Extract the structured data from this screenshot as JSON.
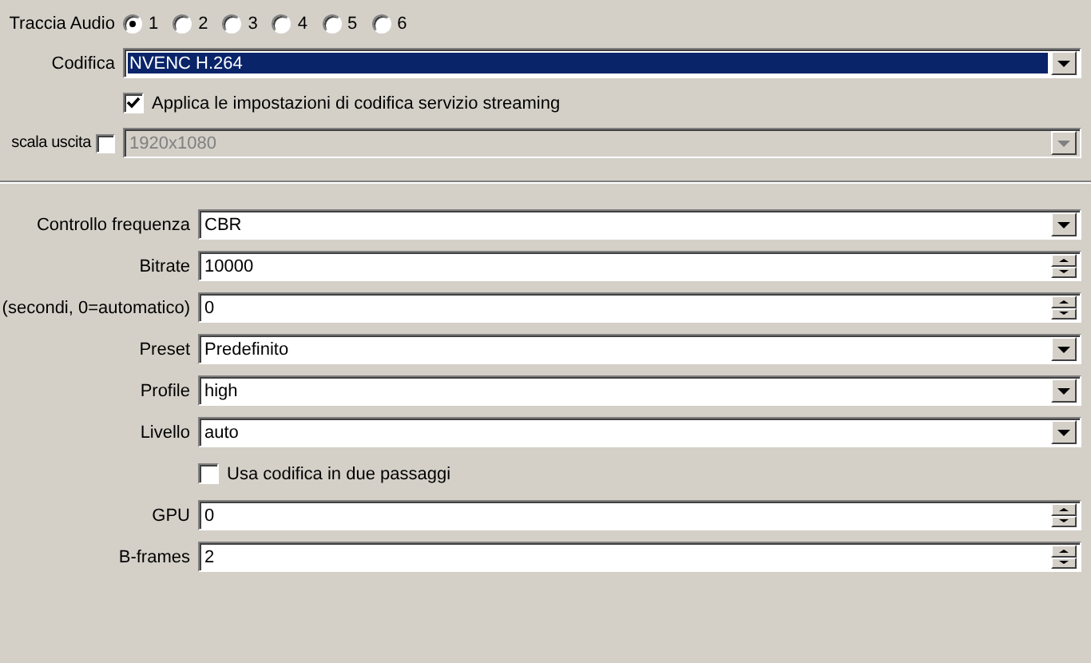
{
  "audio_track": {
    "label": "Traccia Audio",
    "options": [
      {
        "label": "1",
        "selected": true
      },
      {
        "label": "2",
        "selected": false
      },
      {
        "label": "3",
        "selected": false
      },
      {
        "label": "4",
        "selected": false
      },
      {
        "label": "5",
        "selected": false
      },
      {
        "label": "6",
        "selected": false
      }
    ]
  },
  "top_rows": [
    {
      "kind": "combo",
      "label": "Codifica",
      "value": "NVENC H.264",
      "focused": true,
      "disabled": false
    },
    {
      "kind": "check",
      "label": "Applica le impostazioni di codifica servizio streaming",
      "checked": true
    },
    {
      "kind": "rescale",
      "label": "scala uscita",
      "checked": false,
      "value": "1920x1080",
      "disabled": true
    }
  ],
  "rows": [
    {
      "kind": "combo",
      "label": "Controllo frequenza",
      "value": "CBR",
      "focused": false,
      "disabled": false
    },
    {
      "kind": "spin",
      "label": "Bitrate",
      "value": "10000"
    },
    {
      "kind": "spin",
      "label": "(secondi, 0=automatico)",
      "value": "0"
    },
    {
      "kind": "combo",
      "label": "Preset",
      "value": "Predefinito",
      "focused": false,
      "disabled": false
    },
    {
      "kind": "combo",
      "label": "Profile",
      "value": "high",
      "focused": false,
      "disabled": false
    },
    {
      "kind": "combo",
      "label": "Livello",
      "value": "auto",
      "focused": false,
      "disabled": false
    },
    {
      "kind": "check",
      "label": "Usa codifica in due passaggi",
      "checked": false
    },
    {
      "kind": "spin",
      "label": "GPU",
      "value": "0"
    },
    {
      "kind": "spin",
      "label": "B-frames",
      "value": "2"
    }
  ]
}
